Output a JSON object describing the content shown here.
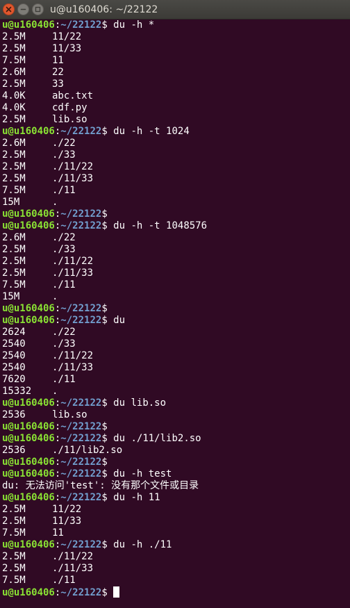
{
  "window": {
    "title": "u@u160406: ~/22122"
  },
  "colors": {
    "background": "#300a24",
    "user": "#8ae234",
    "path": "#729fcf",
    "text": "#ffffff"
  },
  "icons": {
    "close": "close-icon",
    "minimize": "minimize-icon",
    "maximize": "maximize-icon"
  },
  "terminal": {
    "lines": [
      {
        "type": "prompt",
        "user": "u@u160406",
        "sep": ":",
        "path": "~/22122",
        "dollar": "$ ",
        "cmd": "du -h *"
      },
      {
        "type": "out",
        "size": "2.5M",
        "name": "11/22"
      },
      {
        "type": "out",
        "size": "2.5M",
        "name": "11/33"
      },
      {
        "type": "out",
        "size": "7.5M",
        "name": "11"
      },
      {
        "type": "out",
        "size": "2.6M",
        "name": "22"
      },
      {
        "type": "out",
        "size": "2.5M",
        "name": "33"
      },
      {
        "type": "out",
        "size": "4.0K",
        "name": "abc.txt"
      },
      {
        "type": "out",
        "size": "4.0K",
        "name": "cdf.py"
      },
      {
        "type": "out",
        "size": "2.5M",
        "name": "lib.so"
      },
      {
        "type": "prompt",
        "user": "u@u160406",
        "sep": ":",
        "path": "~/22122",
        "dollar": "$ ",
        "cmd": "du -h -t 1024"
      },
      {
        "type": "out",
        "size": "2.6M",
        "name": "./22"
      },
      {
        "type": "out",
        "size": "2.5M",
        "name": "./33"
      },
      {
        "type": "out",
        "size": "2.5M",
        "name": "./11/22"
      },
      {
        "type": "out",
        "size": "2.5M",
        "name": "./11/33"
      },
      {
        "type": "out",
        "size": "7.5M",
        "name": "./11"
      },
      {
        "type": "out",
        "size": "15M",
        "name": "."
      },
      {
        "type": "prompt",
        "user": "u@u160406",
        "sep": ":",
        "path": "~/22122",
        "dollar": "$",
        "cmd": ""
      },
      {
        "type": "prompt",
        "user": "u@u160406",
        "sep": ":",
        "path": "~/22122",
        "dollar": "$ ",
        "cmd": "du -h -t 1048576"
      },
      {
        "type": "out",
        "size": "2.6M",
        "name": "./22"
      },
      {
        "type": "out",
        "size": "2.5M",
        "name": "./33"
      },
      {
        "type": "out",
        "size": "2.5M",
        "name": "./11/22"
      },
      {
        "type": "out",
        "size": "2.5M",
        "name": "./11/33"
      },
      {
        "type": "out",
        "size": "7.5M",
        "name": "./11"
      },
      {
        "type": "out",
        "size": "15M",
        "name": "."
      },
      {
        "type": "prompt",
        "user": "u@u160406",
        "sep": ":",
        "path": "~/22122",
        "dollar": "$",
        "cmd": ""
      },
      {
        "type": "prompt",
        "user": "u@u160406",
        "sep": ":",
        "path": "~/22122",
        "dollar": "$ ",
        "cmd": "du"
      },
      {
        "type": "out",
        "size": "2624",
        "name": "./22"
      },
      {
        "type": "out",
        "size": "2540",
        "name": "./33"
      },
      {
        "type": "out",
        "size": "2540",
        "name": "./11/22"
      },
      {
        "type": "out",
        "size": "2540",
        "name": "./11/33"
      },
      {
        "type": "out",
        "size": "7620",
        "name": "./11"
      },
      {
        "type": "out",
        "size": "15332",
        "name": "."
      },
      {
        "type": "prompt",
        "user": "u@u160406",
        "sep": ":",
        "path": "~/22122",
        "dollar": "$ ",
        "cmd": "du lib.so"
      },
      {
        "type": "out",
        "size": "2536",
        "name": "lib.so"
      },
      {
        "type": "prompt",
        "user": "u@u160406",
        "sep": ":",
        "path": "~/22122",
        "dollar": "$",
        "cmd": ""
      },
      {
        "type": "prompt",
        "user": "u@u160406",
        "sep": ":",
        "path": "~/22122",
        "dollar": "$ ",
        "cmd": "du ./11/lib2.so"
      },
      {
        "type": "out",
        "size": "2536",
        "name": "./11/lib2.so"
      },
      {
        "type": "prompt",
        "user": "u@u160406",
        "sep": ":",
        "path": "~/22122",
        "dollar": "$",
        "cmd": ""
      },
      {
        "type": "prompt",
        "user": "u@u160406",
        "sep": ":",
        "path": "~/22122",
        "dollar": "$ ",
        "cmd": "du -h test"
      },
      {
        "type": "text",
        "text": "du: 无法访问'test': 没有那个文件或目录"
      },
      {
        "type": "prompt",
        "user": "u@u160406",
        "sep": ":",
        "path": "~/22122",
        "dollar": "$ ",
        "cmd": "du -h 11"
      },
      {
        "type": "out",
        "size": "2.5M",
        "name": "11/22"
      },
      {
        "type": "out",
        "size": "2.5M",
        "name": "11/33"
      },
      {
        "type": "out",
        "size": "7.5M",
        "name": "11"
      },
      {
        "type": "prompt",
        "user": "u@u160406",
        "sep": ":",
        "path": "~/22122",
        "dollar": "$ ",
        "cmd": "du -h ./11"
      },
      {
        "type": "out",
        "size": "2.5M",
        "name": "./11/22"
      },
      {
        "type": "out",
        "size": "2.5M",
        "name": "./11/33"
      },
      {
        "type": "out",
        "size": "7.5M",
        "name": "./11"
      },
      {
        "type": "prompt",
        "user": "u@u160406",
        "sep": ":",
        "path": "~/22122",
        "dollar": "$ ",
        "cmd": "",
        "cursor": true
      }
    ]
  }
}
